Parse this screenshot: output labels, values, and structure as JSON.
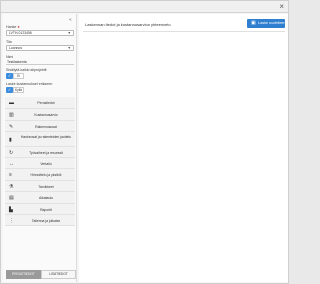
{
  "window": {
    "close_glyph": "×"
  },
  "sidebar": {
    "collapse_glyph": "«",
    "field1": {
      "label": "Hanke",
      "required_mark": "●",
      "value": "LVTH-0123456"
    },
    "field2": {
      "label": "Tila",
      "value": "Luonnos"
    },
    "field3": {
      "label": "Nimi",
      "value": "Testilaskenta"
    },
    "toggle1": {
      "label": "Sisällytä kaikki aliprojektit",
      "on_icon": "✓",
      "off_label": "Ei"
    },
    "toggle2": {
      "label": "Laske kustannukset erikseen",
      "on_icon": "✓",
      "off_label": "Kyllä"
    },
    "menu": [
      {
        "icon": "▬",
        "label": "Perustiedot"
      },
      {
        "icon": "▥",
        "label": "Kustannusarvio"
      },
      {
        "icon": "✎",
        "label": "Rakennusosat"
      },
      {
        "icon": "▮",
        "label": "Hankeosat ja rakenteiden jaottelu"
      },
      {
        "icon": "↻",
        "label": "Työvaiheet ja resurssit"
      },
      {
        "icon": "↔",
        "label": "Vertailu"
      },
      {
        "icon": "≡",
        "label": "Hinnoittelu ja yksiköt"
      },
      {
        "icon": "⚗",
        "label": "Tarvikkeet"
      },
      {
        "icon": "▤",
        "label": "Aikataulu"
      },
      {
        "icon": "▙",
        "label": "Raportit"
      },
      {
        "icon": "⋮",
        "label": "Tallenna ja julkaise"
      }
    ],
    "tabs": {
      "active": "PERUSTIEDOT",
      "inactive": "LISÄTIEDOT"
    }
  },
  "main": {
    "title": "Laskennan tiedot ja kustannusarvion yhteenveto",
    "calc_button": {
      "icon": "▣",
      "label": "Laske uudelleen"
    }
  }
}
